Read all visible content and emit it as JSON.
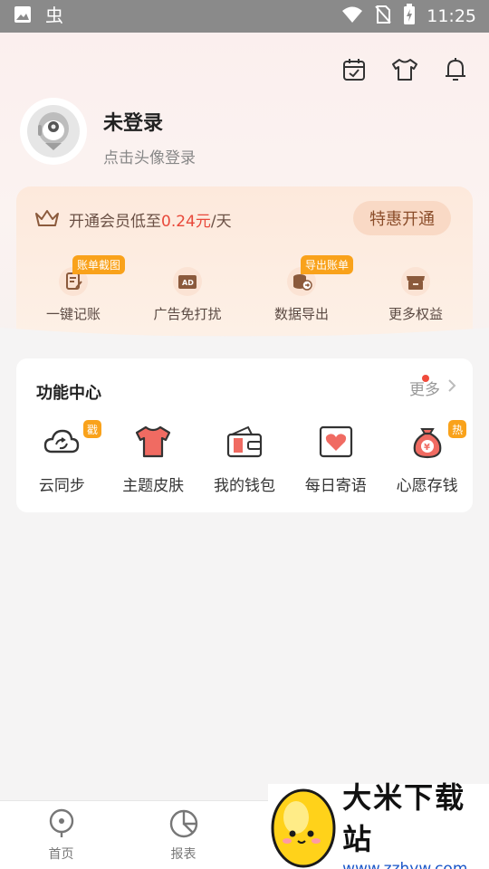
{
  "status_bar": {
    "time": "11:25",
    "icons": [
      "image-icon",
      "bug-icon",
      "wifi-icon",
      "no-sim-icon",
      "battery-charging-icon"
    ]
  },
  "header": {
    "actions": [
      "calendar-check-icon",
      "tshirt-icon",
      "bell-icon"
    ],
    "user": {
      "name": "未登录",
      "hint": "点击头像登录"
    }
  },
  "vip": {
    "text": "开通会员低至0.24元/天",
    "button": "特惠开通",
    "items": [
      {
        "label": "一键记账",
        "icon": "note-edit-icon",
        "badge": "账单截图"
      },
      {
        "label": "广告免打扰",
        "icon": "ad-block-icon",
        "badge": ""
      },
      {
        "label": "数据导出",
        "icon": "data-export-icon",
        "badge": "导出账单"
      },
      {
        "label": "更多权益",
        "icon": "store-icon",
        "badge": ""
      }
    ]
  },
  "functions": {
    "title": "功能中心",
    "more": "更多",
    "items": [
      {
        "label": "云同步",
        "icon": "cloud-sync-icon",
        "badge": "戳"
      },
      {
        "label": "主题皮肤",
        "icon": "theme-shirt-icon",
        "badge": ""
      },
      {
        "label": "我的钱包",
        "icon": "wallet-icon",
        "badge": ""
      },
      {
        "label": "每日寄语",
        "icon": "heart-card-icon",
        "badge": ""
      },
      {
        "label": "心愿存钱",
        "icon": "money-bag-icon",
        "badge": "热"
      }
    ]
  },
  "bottom_nav": {
    "items": [
      {
        "label": "首页",
        "icon": "home-pin-icon"
      },
      {
        "label": "报表",
        "icon": "pie-chart-icon"
      }
    ]
  },
  "watermark": {
    "title": "大米下载站",
    "url": "www.zzhyw.com"
  },
  "colors": {
    "accent_orange": "#f9a21b",
    "vip_button_bg": "#f9d9c5",
    "price_red": "#e8483a",
    "link_blue": "#1a56c8"
  }
}
